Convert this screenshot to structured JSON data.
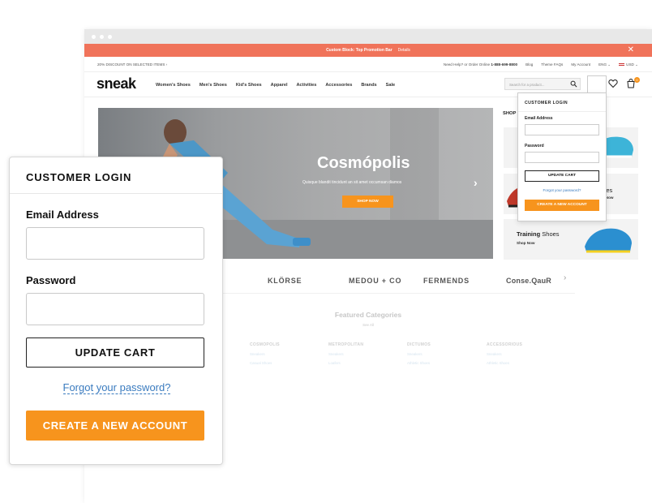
{
  "promo": {
    "text": "Custom Block: Top Promotion Bar",
    "details": "Details",
    "close": "✕"
  },
  "topbar": {
    "discount": "20% DISCOUNT ON SELECTED ITEMS  ›",
    "help_prefix": "Need Help? or Order Online",
    "phone": "1-888-699-8800",
    "links": [
      "Blog",
      "Theme FAQs",
      "My Account",
      "ENG ⌄",
      "USD ⌄"
    ]
  },
  "header": {
    "logo": "sneak",
    "nav": [
      "Women's Shoes",
      "Men's Shoes",
      "Kid's Shoes",
      "Apparel",
      "Activities",
      "Accessories",
      "Brands",
      "Sale"
    ],
    "search_placeholder": "Search for a product...",
    "cart_count": "0"
  },
  "hero": {
    "title": "Cosmópolis",
    "subtitle": "Quisque blandit tincidunt an sit amet occumsan diamos",
    "button": "SHOP NOW",
    "next": "›"
  },
  "shop": {
    "heading": "SHOP",
    "cards": [
      {
        "label_bold": "",
        "label": "",
        "cta": ""
      },
      {
        "label_bold": "",
        "label": "Shoes",
        "cta": "Shop Now"
      },
      {
        "label_bold": "Training",
        "label": "Shoes",
        "cta": "Shop Now"
      }
    ]
  },
  "brands": [
    "S",
    "KLÖRSE",
    "MEDOU + CO",
    "FERMENDS",
    "Conse.QauR"
  ],
  "brands_next": "›",
  "featured": {
    "title": "Featured Categories",
    "see_all": "See All",
    "columns": [
      {
        "heading": "COSMOPOLIS",
        "links": [
          "Sneakers",
          "Casual Shoes"
        ]
      },
      {
        "heading": "METROPOLITAN",
        "links": [
          "Sneakers",
          "Loafers"
        ]
      },
      {
        "heading": "DICTUMOS",
        "links": [
          "Sneakers",
          "Athletic Shoes"
        ]
      },
      {
        "heading": "ACCESSORIOUS",
        "links": [
          "Sneakers",
          "Athletic Shoes"
        ]
      }
    ]
  },
  "mini_login": {
    "title": "CUSTOMER LOGIN",
    "email_label": "Email Address",
    "password_label": "Password",
    "update": "UPDATE CART",
    "forgot": "Forgot your password?",
    "create": "CREATE A NEW ACCOUNT"
  },
  "login_panel": {
    "title": "CUSTOMER LOGIN",
    "email_label": "Email Address",
    "email_value": "",
    "password_label": "Password",
    "password_value": "",
    "update": "UPDATE CART",
    "forgot": "Forgot your password?",
    "create": "CREATE A NEW ACCOUNT"
  },
  "colors": {
    "accent": "#f7941d",
    "promo": "#f0735a",
    "link": "#3a7bbf"
  }
}
